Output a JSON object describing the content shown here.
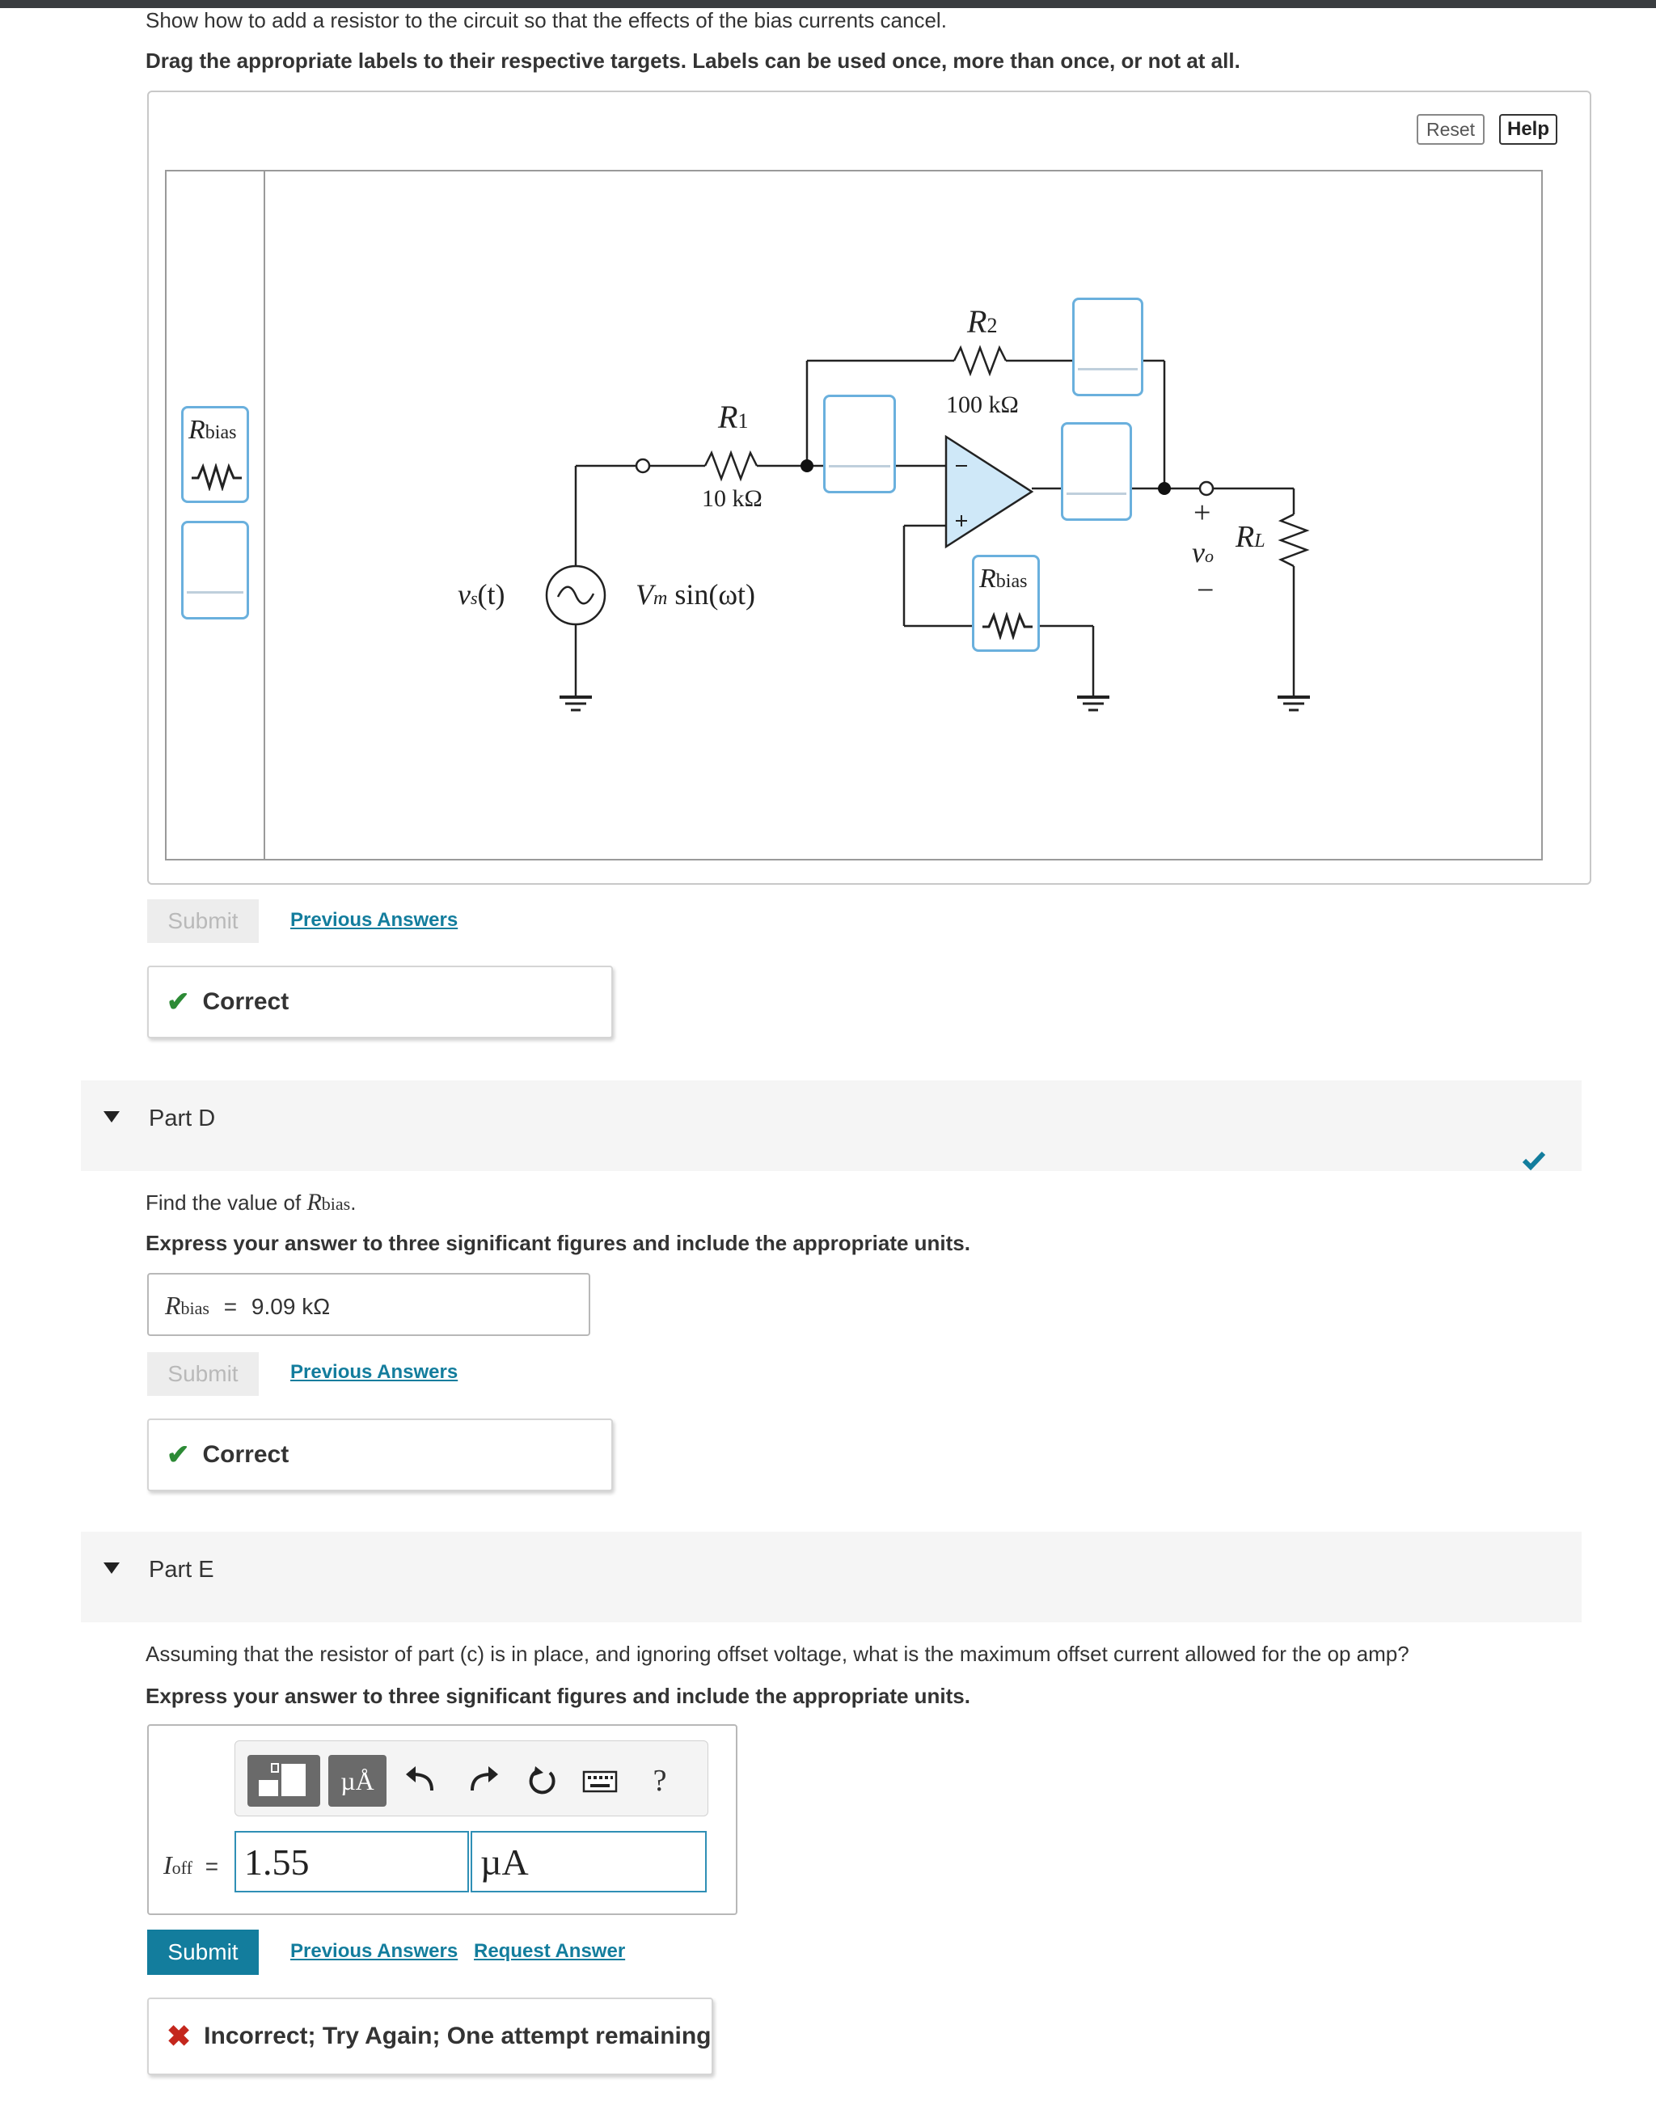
{
  "partC": {
    "instruction": "Show how to add a resistor to the circuit so that the effects of the bias currents cancel.",
    "directions": "Drag the appropriate labels to their respective targets. Labels can be used once, more than once, or not at all.",
    "reset_label": "Reset",
    "help_label": "Help",
    "palette_label_main": "R",
    "palette_label_sub": "bias",
    "circuit": {
      "r1_name": "R",
      "r1_sub": "1",
      "r1_value": "10 kΩ",
      "r2_name": "R",
      "r2_sub": "2",
      "r2_value": "100 kΩ",
      "rbias_main": "R",
      "rbias_sub": "bias",
      "vs_label": "v",
      "vs_sub": "s",
      "vs_arg": "(t)",
      "source_expr_v": "V",
      "source_expr_sub": "m",
      "source_expr_rest": " sin(ωt)",
      "vo_label": "v",
      "vo_sub": "o",
      "rl_name": "R",
      "rl_sub": "L",
      "plus": "+",
      "minus": "−"
    },
    "submit_label": "Submit",
    "previous_answers": "Previous Answers",
    "feedback": "Correct"
  },
  "partD": {
    "title": "Part D",
    "question_prefix": "Find the value of ",
    "question_var": "R",
    "question_sub": "bias",
    "question_suffix": ".",
    "instruction": "Express your answer to three significant figures and include the appropriate units.",
    "answer_var": "R",
    "answer_sub": "bias",
    "equals": "=",
    "answer_value": "9.09 kΩ",
    "submit_label": "Submit",
    "previous_answers": "Previous Answers",
    "feedback": "Correct"
  },
  "partE": {
    "title": "Part E",
    "question": "Assuming that the resistor of part (c) is in place, and ignoring offset voltage, what is the maximum offset current allowed for the op amp?",
    "instruction": "Express your answer to three significant figures and include the appropriate units.",
    "toolbar": {
      "units_icon": "µÅ",
      "help_icon": "?"
    },
    "answer_var": "I",
    "answer_sub": "off",
    "equals": "=",
    "value": "1.55",
    "unit": "µA",
    "submit_label": "Submit",
    "previous_answers": "Previous Answers",
    "request_answer": "Request Answer",
    "feedback": "Incorrect; Try Again; One attempt remaining"
  },
  "colors": {
    "link": "#137d9d",
    "submit": "#137d9d",
    "correct": "#2c8a35",
    "incorrect": "#c4271d",
    "slot_border": "#6ab0dd",
    "opamp_fill": "#cfe8f8"
  }
}
